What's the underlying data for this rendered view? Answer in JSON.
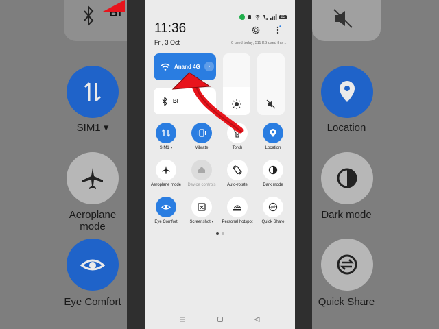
{
  "status": {
    "time": "11:36",
    "date": "Fri, 3 Oct",
    "battery": "83",
    "usage": "0 used today; 511 KB used this ..."
  },
  "tiles": {
    "wifi": {
      "label": "Anand 4G"
    },
    "bluetooth": {
      "label": "Bl"
    }
  },
  "toggles": [
    {
      "label": "SIM1 ▾",
      "icon": "data-transfer-icon",
      "state": "on"
    },
    {
      "label": "Vibrate",
      "icon": "vibrate-icon",
      "state": "on"
    },
    {
      "label": "Torch",
      "icon": "torch-icon",
      "state": "off"
    },
    {
      "label": "Location",
      "icon": "location-icon",
      "state": "on"
    },
    {
      "label": "Aeroplane mode",
      "icon": "aeroplane-icon",
      "state": "off"
    },
    {
      "label": "Device controls",
      "icon": "home-icon",
      "state": "disabled"
    },
    {
      "label": "Auto-rotate",
      "icon": "auto-rotate-icon",
      "state": "off"
    },
    {
      "label": "Dark mode",
      "icon": "dark-mode-icon",
      "state": "off"
    },
    {
      "label": "Eye Comfort",
      "icon": "eye-icon",
      "state": "on"
    },
    {
      "label": "Screenshot ▾",
      "icon": "screenshot-icon",
      "state": "off"
    },
    {
      "label": "Personal hotspot",
      "icon": "hotspot-icon",
      "state": "off"
    },
    {
      "label": "Quick Share",
      "icon": "quick-share-icon",
      "state": "off"
    }
  ],
  "sliders": {
    "brightness_level": 0.46,
    "volume_level": 0.0
  },
  "background_zoom": {
    "left": {
      "sim": "SIM1 ▾",
      "aeroplane": "Aeroplane mode",
      "eye": "Eye Comfort",
      "bt_partial": "Bl"
    },
    "right": {
      "location": "Location",
      "dark": "Dark mode",
      "share": "Quick Share"
    }
  },
  "colors": {
    "accent": "#2a7de1",
    "arrow": "#e8141c",
    "panel": "#ebebeb"
  }
}
